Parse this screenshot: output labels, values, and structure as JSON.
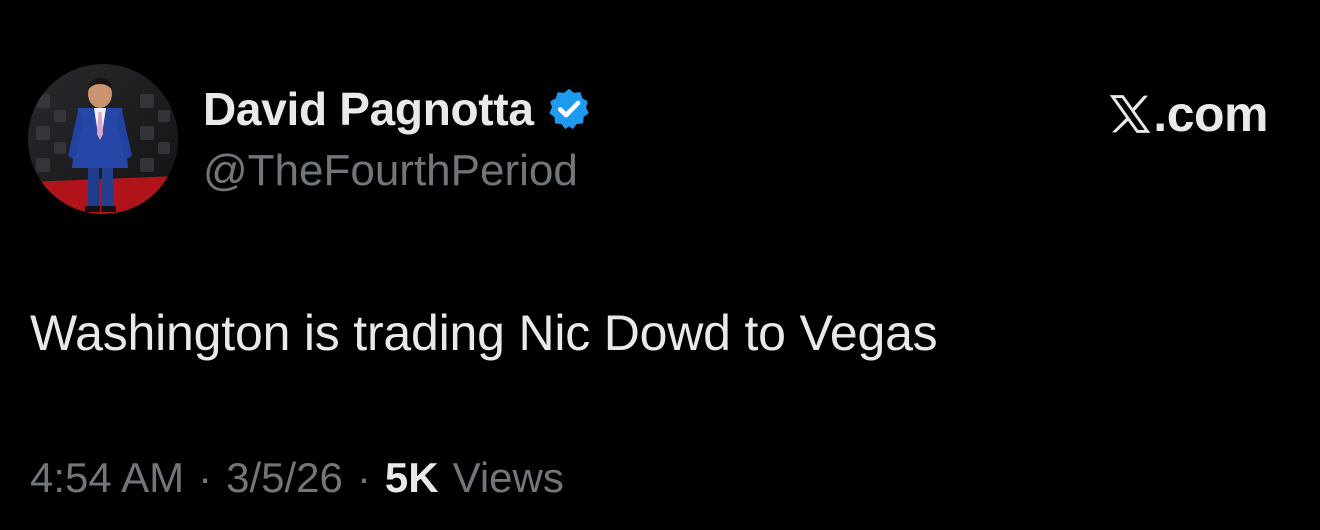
{
  "author": {
    "display_name": "David Pagnotta",
    "handle": "@TheFourthPeriod",
    "verified": true,
    "verified_color": "#1d9bf0",
    "avatar": "avatar-man-in-blue-suit"
  },
  "brand": {
    "icon": "x-logo-icon",
    "text": ".com"
  },
  "tweet": {
    "text": "Washington is trading Nic Dowd to Vegas"
  },
  "meta": {
    "time": "4:54 AM",
    "separator": "·",
    "date": "3/5/26",
    "views_count": "5K",
    "views_label": "Views"
  },
  "colors": {
    "background": "#000000",
    "primary_text": "#e7e9ea",
    "secondary_text": "#71767b"
  }
}
